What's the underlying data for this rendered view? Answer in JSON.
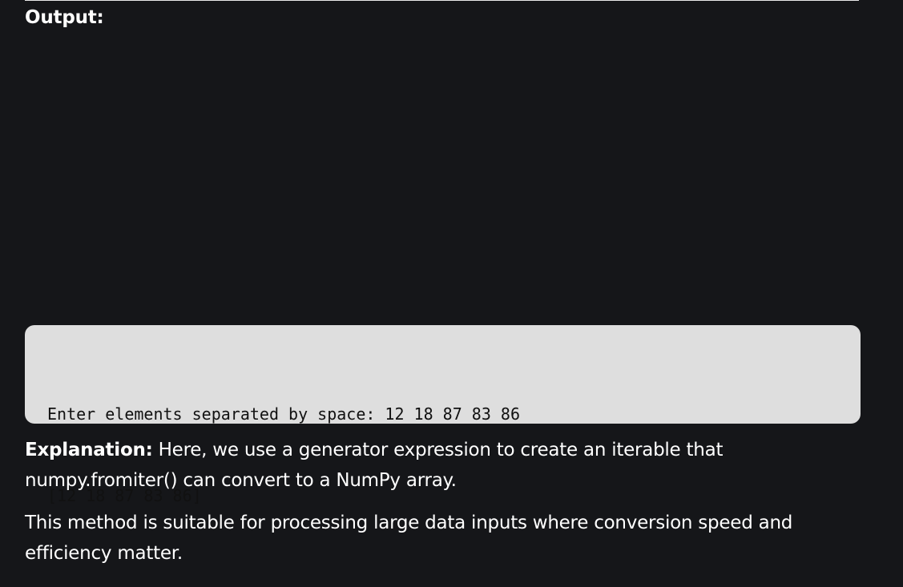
{
  "output": {
    "heading": "Output:"
  },
  "terminal": {
    "lines": [
      "Enter elements separated by space: 12 18 87 83 86",
      "[12 18 87 83 86]"
    ]
  },
  "explanation": {
    "label": "Explanation:",
    "text": " Here, we use a generator expression to create an iterable that numpy.fromiter() can convert to a NumPy array."
  },
  "method_note": {
    "text": "This method is suitable for processing large data inputs where conversion speed and efficiency matter."
  }
}
